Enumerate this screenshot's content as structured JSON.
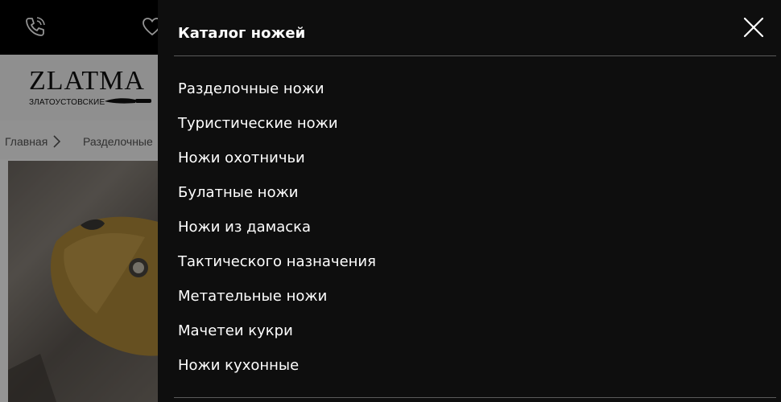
{
  "header": {
    "logo_text": "ZLATMA",
    "logo_subtitle": "ЗЛАТОУСТОВСКИЕ"
  },
  "breadcrumb": {
    "home": "Главная",
    "current": "Разделочные"
  },
  "drawer": {
    "title": "Каталог ножей",
    "items": [
      {
        "label": "Разделочные ножи"
      },
      {
        "label": "Туристические ножи"
      },
      {
        "label": "Ножи охотничьи"
      },
      {
        "label": "Булатные ножи"
      },
      {
        "label": "Ножи из дамаска"
      },
      {
        "label": "Тактического назначения"
      },
      {
        "label": "Метательные ножи"
      },
      {
        "label": "Мачетеи кукри"
      },
      {
        "label": "Ножи кухонные"
      }
    ]
  },
  "icons": {
    "phone": "phone-icon",
    "favorites": "heart-icon",
    "close": "close-icon"
  },
  "colors": {
    "drawer_bg": "#0e0e0e",
    "topbar_bg": "#000000",
    "text_on_dark": "#ffffff"
  }
}
